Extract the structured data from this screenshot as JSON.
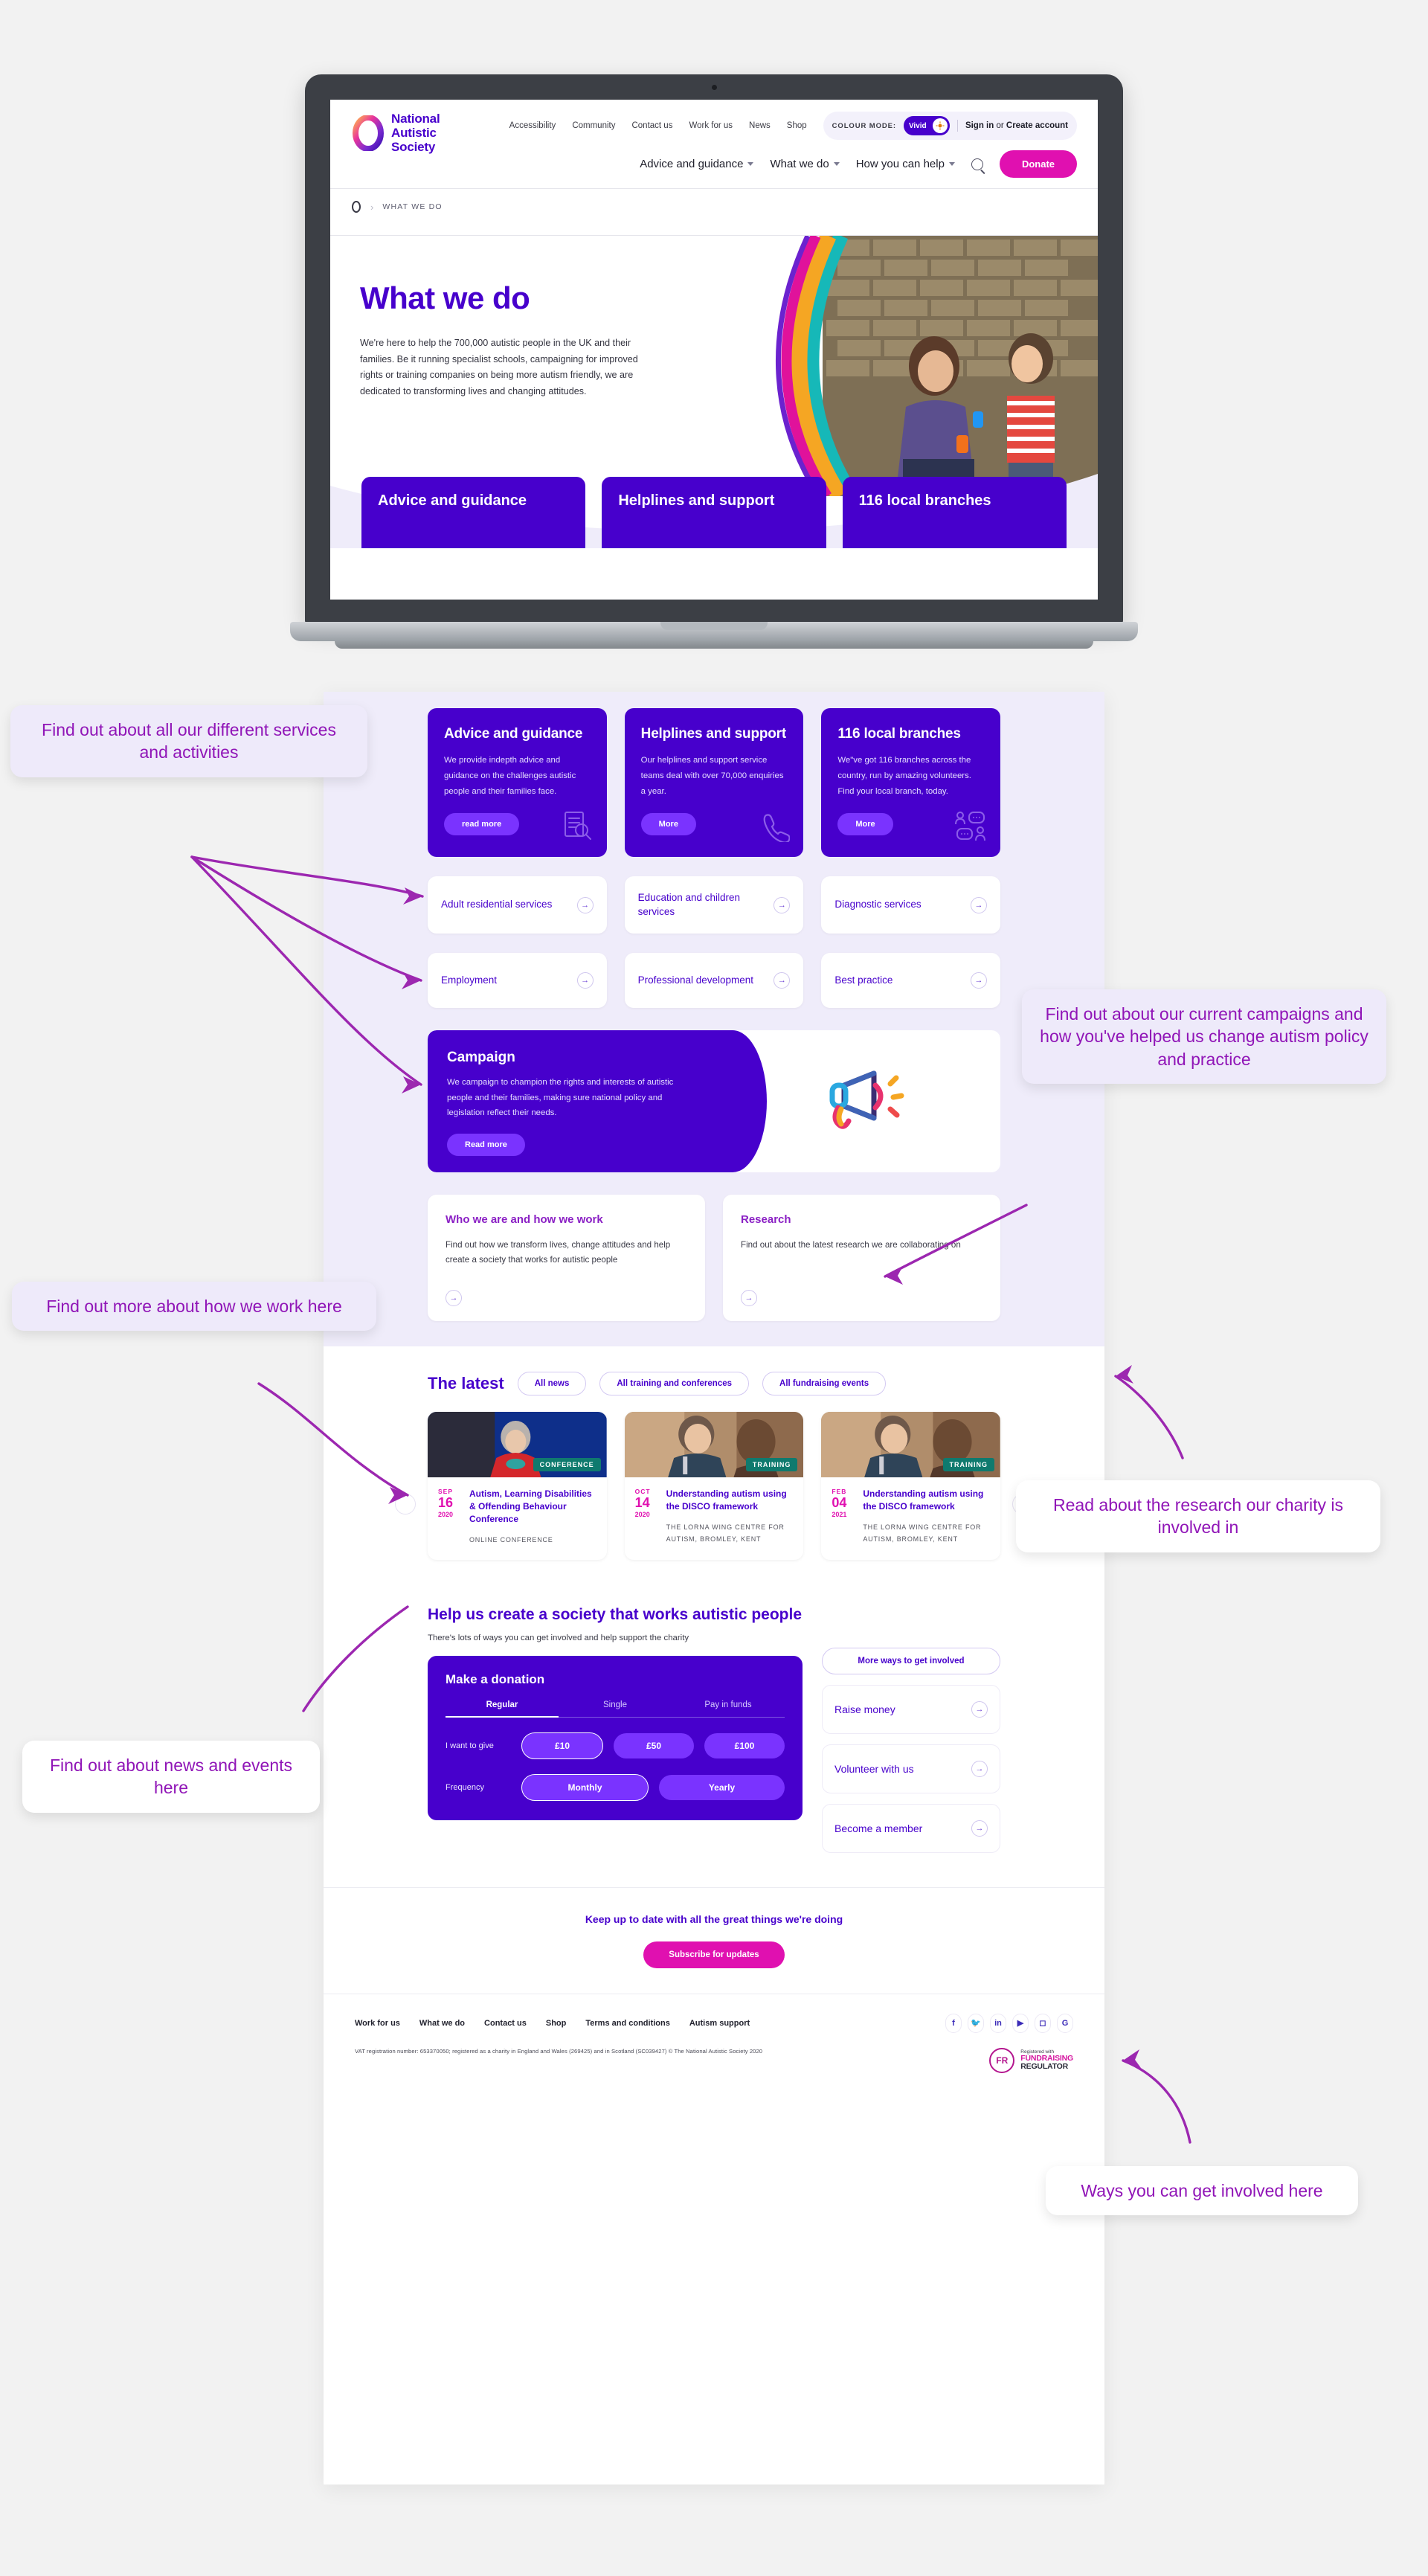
{
  "site": {
    "brand": {
      "line1": "National",
      "line2": "Autistic",
      "line3": "Society"
    },
    "util_links": [
      "Accessibility",
      "Community",
      "Contact us",
      "Work for us",
      "News",
      "Shop"
    ],
    "colour_mode": {
      "label": "COLOUR MODE:",
      "value": "Vivid",
      "icon": "sun-icon"
    },
    "account": {
      "sign_in": "Sign in",
      "or": " or ",
      "create": "Create account"
    },
    "nav": [
      "Advice and guidance",
      "What we do",
      "How you can help"
    ],
    "search_icon": "search-icon",
    "donate_label": "Donate",
    "breadcrumb": {
      "home_icon": "home-icon",
      "current": "WHAT WE DO"
    },
    "hero": {
      "title": "What we do",
      "body": "We're here to help the 700,000 autistic people in the UK and their families. Be it running specialist schools, campaigning for improved rights or training companies on being more autism friendly, we are dedicated to transforming lives and changing attitudes.",
      "scroll_icon": "down-arrow-icon"
    },
    "peek_cards": [
      "Advice and guidance",
      "Helplines and support",
      "116 local branches"
    ]
  },
  "promo_cards": [
    {
      "title": "Advice and guidance",
      "body": "We provide indepth advice and guidance on the challenges autistic people and their families face.",
      "button": "read more",
      "icon": "document-search-icon"
    },
    {
      "title": "Helplines and support",
      "body": "Our helplines and support service teams deal with over 70,000 enquiries a year.",
      "button": "More",
      "icon": "phone-icon"
    },
    {
      "title": "116 local branches",
      "body": "We\"ve got 116 branches across the country, run by amazing volunteers. Find your local branch, today.",
      "button": "More",
      "icon": "people-chat-icon"
    }
  ],
  "service_links": [
    "Adult residential services",
    "Education and children services",
    "Diagnostic services",
    "Employment",
    "Professional development",
    "Best practice"
  ],
  "campaign": {
    "title": "Campaign",
    "body": "We campaign to champion the rights and interests of autistic people and their families, making sure national policy and legislation reflect their needs.",
    "button": "Read more",
    "icon": "megaphone-icon"
  },
  "feature_cards": [
    {
      "title": "Who we are and how we work",
      "body": "Find out how we transform lives, change attitudes and help create a society that works for autistic people"
    },
    {
      "title": "Research",
      "body": "Find out about the latest research we are collaborating on"
    }
  ],
  "latest": {
    "heading": "The latest",
    "filters": [
      "All news",
      "All training and conferences",
      "All fundraising events"
    ],
    "prev_icon": "chevron-left-icon",
    "next_icon": "chevron-right-icon",
    "items": [
      {
        "tag": "CONFERENCE",
        "month": "SEP",
        "day": "16",
        "year": "2020",
        "title": "Autism, Learning Disabilities & Offending Behaviour Conference",
        "location": "ONLINE CONFERENCE"
      },
      {
        "tag": "TRAINING",
        "month": "OCT",
        "day": "14",
        "year": "2020",
        "title": "Understanding autism using the DISCO framework",
        "location": "THE LORNA WING CENTRE FOR AUTISM, BROMLEY, KENT"
      },
      {
        "tag": "TRAINING",
        "month": "FEB",
        "day": "04",
        "year": "2021",
        "title": "Understanding autism using the DISCO framework",
        "location": "THE LORNA WING CENTRE FOR AUTISM, BROMLEY, KENT"
      }
    ]
  },
  "help": {
    "heading": "Help us create a society that works autistic people",
    "sub": "There's lots of ways you can get involved and help support the charity",
    "more_ways": "More ways to get involved",
    "donation": {
      "title": "Make a donation",
      "tabs": [
        "Regular",
        "Single",
        "Pay in funds"
      ],
      "active_tab": "Regular",
      "amount_label": "I want to give",
      "amounts": [
        "£10",
        "£50",
        "£100"
      ],
      "selected_amount": "£10",
      "frequency_label": "Frequency",
      "frequencies": [
        "Monthly",
        "Yearly"
      ],
      "selected_frequency": "Monthly"
    },
    "side_links": [
      "Raise money",
      "Volunteer with us",
      "Become a member"
    ]
  },
  "subscribe": {
    "text": "Keep up to date with all the great things we're doing",
    "button": "Subscribe for updates"
  },
  "footer": {
    "links": [
      "Work for us",
      "What we do",
      "Contact us",
      "Shop",
      "Terms and conditions",
      "Autism support"
    ],
    "socials": [
      "facebook-icon",
      "twitter-icon",
      "linkedin-icon",
      "youtube-icon",
      "instagram-icon",
      "google-icon"
    ],
    "vat": "VAT registration number: 653370050; registered as a charity in England and Wales (269425) and in Scotland (SC039427) © The National Autistic Society 2020",
    "regulator": {
      "mark": "FR",
      "line1": "Registered with",
      "line2": "FUNDRAISING",
      "line3": "REGULATOR"
    }
  },
  "callouts": [
    {
      "text": "Find out about all our different services and activities"
    },
    {
      "text": "Find out about our current campaigns and how you've helped us change autism policy and practice"
    },
    {
      "text": "Find out more about how we work here"
    },
    {
      "text": "Read about the research our charity is involved in"
    },
    {
      "text": "Find out about news and events here"
    },
    {
      "text": "Ways you can get involved here"
    }
  ],
  "colors": {
    "purple": "#4700cc",
    "magenta": "#e010b0",
    "annotation": "#9015b7",
    "lavender_bg": "#efecfa",
    "teal_tag": "#0f7a6e"
  }
}
